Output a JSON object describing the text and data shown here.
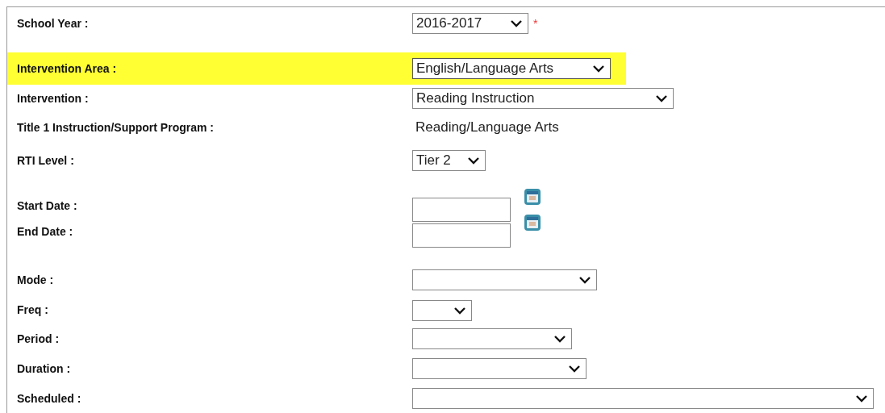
{
  "fields": [
    {
      "label": "School Year :",
      "kind": "select",
      "value": "2016-2017",
      "required_mark": "*",
      "highlighted": false
    },
    {
      "label": "Intervention Area :",
      "kind": "select",
      "value": "English/Language Arts",
      "highlighted": true
    },
    {
      "label": "Intervention :",
      "kind": "select",
      "value": "Reading Instruction",
      "highlighted": false
    },
    {
      "label": "Title 1 Instruction/Support Program :",
      "kind": "text",
      "value": "Reading/Language Arts",
      "highlighted": false
    },
    {
      "label": "RTI Level :",
      "kind": "select",
      "value": "Tier 2",
      "highlighted": false
    },
    {
      "label": "Start Date :",
      "kind": "date",
      "highlighted": false
    },
    {
      "label": "End Date :",
      "kind": "date",
      "highlighted": false
    },
    {
      "label": "Mode :",
      "kind": "select",
      "highlighted": false
    },
    {
      "label": "Freq :",
      "kind": "select",
      "highlighted": false
    },
    {
      "label": "Period :",
      "kind": "select",
      "highlighted": false
    },
    {
      "label": "Duration :",
      "kind": "select",
      "highlighted": false
    },
    {
      "label": "Scheduled :",
      "kind": "select",
      "highlighted": false
    }
  ]
}
